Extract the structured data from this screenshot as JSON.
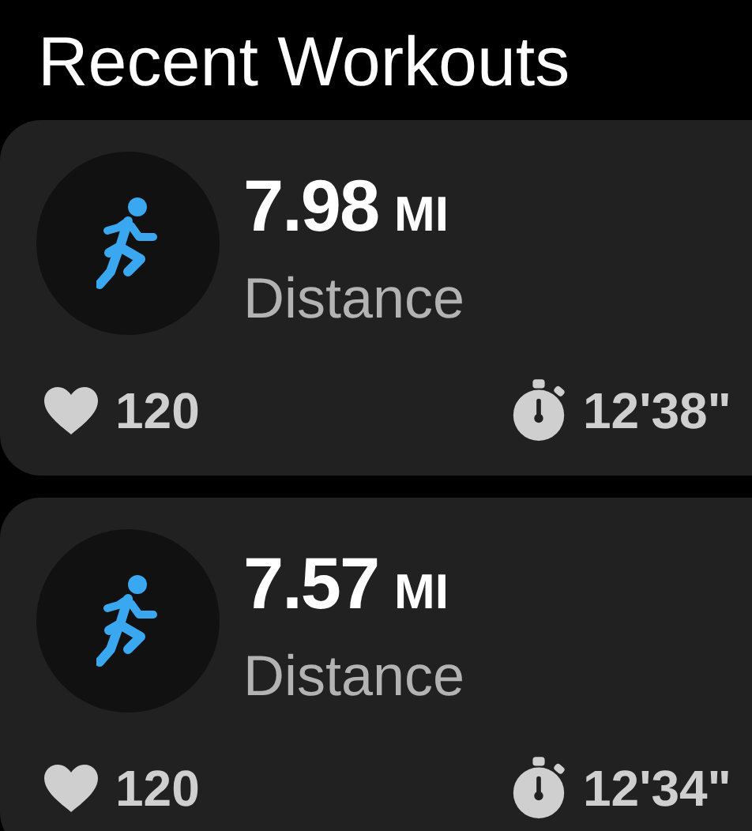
{
  "title": "Recent Workouts",
  "workouts": [
    {
      "value": "7.98",
      "unit": "MI",
      "label": "Distance",
      "heart_rate": "120",
      "time": "12'38\""
    },
    {
      "value": "7.57",
      "unit": "MI",
      "label": "Distance",
      "heart_rate": "120",
      "time": "12'34\""
    }
  ]
}
